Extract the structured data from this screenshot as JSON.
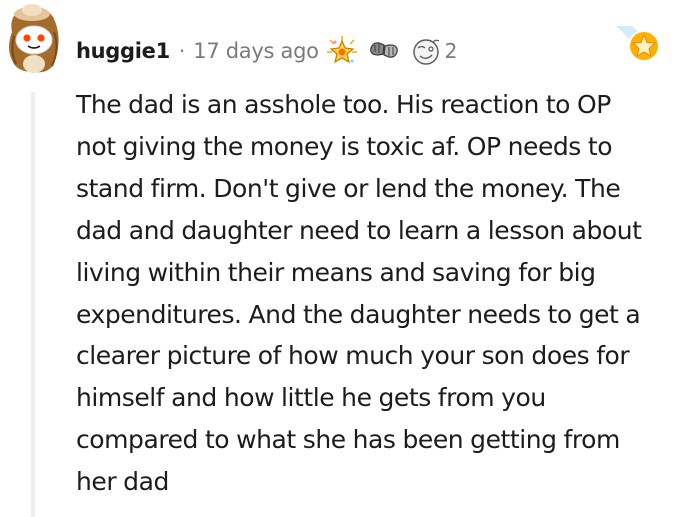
{
  "comment": {
    "username": "huggie1",
    "separator": "·",
    "timestamp": "17 days ago",
    "award_count": "2",
    "avatar_icon": "snoo-avatar-icon",
    "awards": [
      "burst-star-award-icon",
      "fist-bump-award-icon",
      "doodle-face-award-icon"
    ],
    "corner_icon": "star-award-icon",
    "body_lines": [
      "The dad is an asshole too. His reaction to OP",
      "not giving the money is toxic af. OP needs to",
      "stand firm. Don't give or lend the money. The",
      "dad and daughter need to learn a lesson about",
      "living within their means and saving for big",
      "expenditures. And the daughter needs to get a",
      "clearer picture of how much your son does for",
      "himself and how little he gets from you",
      "compared to what she has been getting from",
      "her dad"
    ]
  },
  "colors": {
    "text": "#1c1c1c",
    "meta": "#787c7e",
    "thread_line": "#edeff1",
    "star_gold": "#ffb000",
    "star_bg": "#e8f4ff"
  }
}
